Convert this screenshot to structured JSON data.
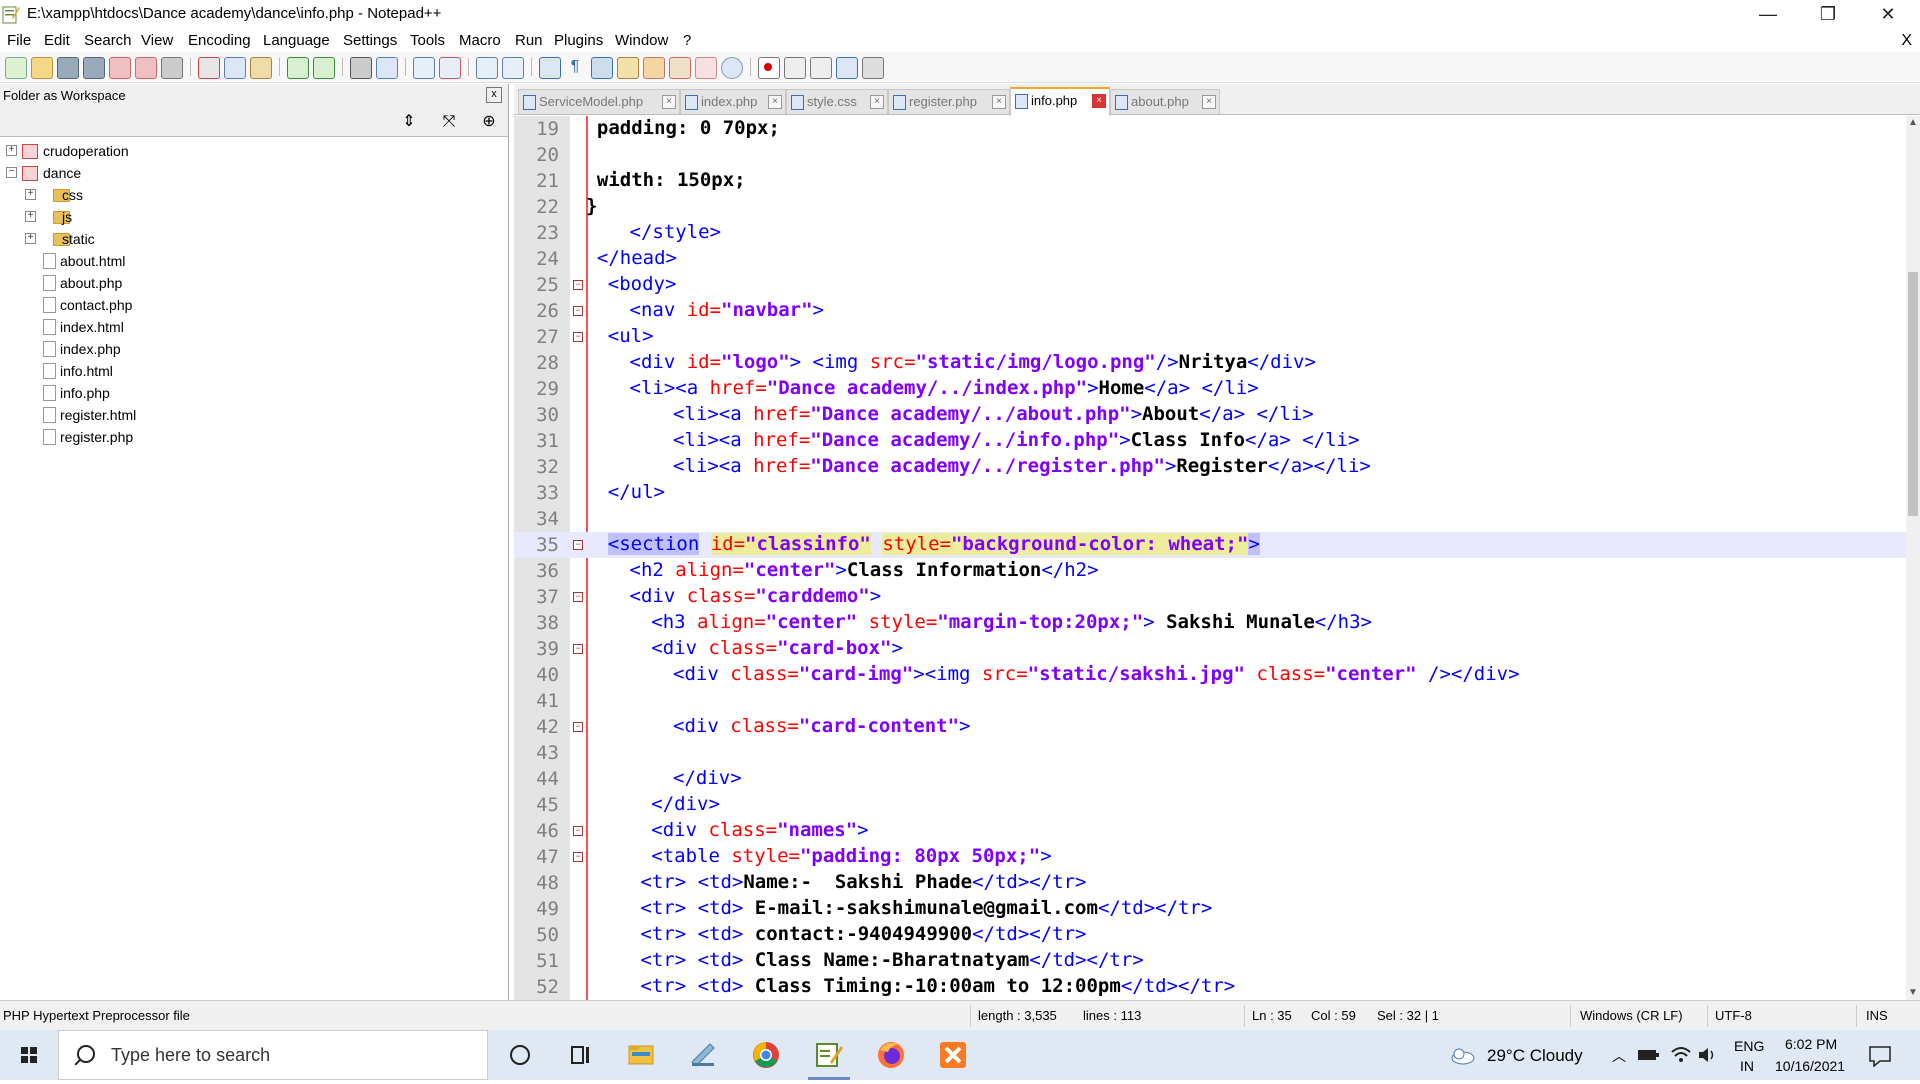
{
  "window": {
    "title": "E:\\xampp\\htdocs\\Dance academy\\dance\\info.php - Notepad++",
    "minimize": "—",
    "maximize": "❐",
    "close": "✕"
  },
  "menu": {
    "items": [
      "File",
      "Edit",
      "Search",
      "View",
      "Encoding",
      "Language",
      "Settings",
      "Tools",
      "Macro",
      "Run",
      "Plugins",
      "Window",
      "?"
    ],
    "close": "X"
  },
  "workspace": {
    "title": "Folder as Workspace",
    "close": "x",
    "tools": [
      "⇕",
      "⤧",
      "⊕"
    ],
    "tree": [
      {
        "label": "crudoperation",
        "type": "project",
        "level": 0,
        "expander": "+"
      },
      {
        "label": "dance",
        "type": "project",
        "level": 0,
        "expander": "−"
      },
      {
        "label": "css",
        "type": "folder",
        "level": 1,
        "expander": "+"
      },
      {
        "label": "js",
        "type": "folder",
        "level": 1,
        "expander": "+"
      },
      {
        "label": "static",
        "type": "folder",
        "level": 1,
        "expander": "+"
      },
      {
        "label": "about.html",
        "type": "file",
        "level": 1
      },
      {
        "label": "about.php",
        "type": "file",
        "level": 1
      },
      {
        "label": "contact.php",
        "type": "file",
        "level": 1
      },
      {
        "label": "index.html",
        "type": "file",
        "level": 1
      },
      {
        "label": "index.php",
        "type": "file",
        "level": 1
      },
      {
        "label": "info.html",
        "type": "file",
        "level": 1
      },
      {
        "label": "info.php",
        "type": "file",
        "level": 1
      },
      {
        "label": "register.html",
        "type": "file",
        "level": 1
      },
      {
        "label": "register.php",
        "type": "file",
        "level": 1
      }
    ]
  },
  "tabs": [
    {
      "label": "ServiceModel.php",
      "active": false
    },
    {
      "label": "index.php",
      "active": false
    },
    {
      "label": "style.css",
      "active": false
    },
    {
      "label": "register.php",
      "active": false
    },
    {
      "label": "info.php",
      "active": true
    },
    {
      "label": "about.php",
      "active": false
    }
  ],
  "editor": {
    "lines": [
      {
        "n": "19",
        "fold": "",
        "parts": [
          [
            "txt",
            "padding: 0 70px;"
          ]
        ],
        "indent": 1
      },
      {
        "n": "20",
        "fold": "",
        "parts": [],
        "indent": 0
      },
      {
        "n": "21",
        "fold": "",
        "parts": [
          [
            "txt",
            "width: 150px;"
          ]
        ],
        "indent": 1
      },
      {
        "n": "22",
        "fold": "",
        "parts": [
          [
            "txt",
            "}"
          ]
        ],
        "indent": 0
      },
      {
        "n": "23",
        "fold": "",
        "parts": [
          [
            "tag",
            "</style>"
          ]
        ],
        "indent": 4
      },
      {
        "n": "24",
        "fold": "",
        "parts": [
          [
            "tag",
            "</head>"
          ]
        ],
        "indent": 1
      },
      {
        "n": "25",
        "fold": "−",
        "parts": [
          [
            "tag",
            "<body>"
          ]
        ],
        "indent": 2
      },
      {
        "n": "26",
        "fold": "−",
        "parts": [
          [
            "tag",
            "<nav "
          ],
          [
            "attr",
            "id="
          ],
          [
            "val",
            "\"navbar\""
          ],
          [
            "tag",
            ">"
          ]
        ],
        "indent": 4
      },
      {
        "n": "27",
        "fold": "−",
        "parts": [
          [
            "tag",
            "<ul>"
          ]
        ],
        "indent": 2
      },
      {
        "n": "28",
        "fold": "",
        "parts": [
          [
            "tag",
            "<div "
          ],
          [
            "attr",
            "id="
          ],
          [
            "val",
            "\"logo\""
          ],
          [
            "tag",
            "> <img "
          ],
          [
            "attr",
            "src="
          ],
          [
            "val",
            "\"static/img/logo.png\""
          ],
          [
            "tag",
            "/>"
          ],
          [
            "txt",
            "Nritya"
          ],
          [
            "tag",
            "</div>"
          ]
        ],
        "indent": 4
      },
      {
        "n": "29",
        "fold": "",
        "parts": [
          [
            "tag",
            "<li><a "
          ],
          [
            "attr",
            "href="
          ],
          [
            "val",
            "\"Dance academy/../index.php\""
          ],
          [
            "tag",
            ">"
          ],
          [
            "txt",
            "Home"
          ],
          [
            "tag",
            "</a> </li>"
          ]
        ],
        "indent": 4
      },
      {
        "n": "30",
        "fold": "",
        "parts": [
          [
            "tag",
            "<li><a "
          ],
          [
            "attr",
            "href="
          ],
          [
            "val",
            "\"Dance academy/../about.php\""
          ],
          [
            "tag",
            ">"
          ],
          [
            "txt",
            "About"
          ],
          [
            "tag",
            "</a> </li>"
          ]
        ],
        "indent": 8
      },
      {
        "n": "31",
        "fold": "",
        "parts": [
          [
            "tag",
            "<li><a "
          ],
          [
            "attr",
            "href="
          ],
          [
            "val",
            "\"Dance academy/../info.php\""
          ],
          [
            "tag",
            ">"
          ],
          [
            "txt",
            "Class Info"
          ],
          [
            "tag",
            "</a> </li>"
          ]
        ],
        "indent": 8
      },
      {
        "n": "32",
        "fold": "",
        "parts": [
          [
            "tag",
            "<li><a "
          ],
          [
            "attr",
            "href="
          ],
          [
            "val",
            "\"Dance academy/../register.php\""
          ],
          [
            "tag",
            ">"
          ],
          [
            "txt",
            "Register"
          ],
          [
            "tag",
            "</a></li>"
          ]
        ],
        "indent": 8
      },
      {
        "n": "33",
        "fold": "",
        "parts": [
          [
            "tag",
            "</ul>"
          ]
        ],
        "indent": 2
      },
      {
        "n": "34",
        "fold": "",
        "parts": [],
        "indent": 0
      },
      {
        "n": "35",
        "fold": "−",
        "current": true,
        "parts": [
          [
            "tag hlsel",
            "<section"
          ],
          [
            "txt",
            " "
          ],
          [
            "attr hlfind",
            "id="
          ],
          [
            "val hlfind",
            "\"classinfo\""
          ],
          [
            "txt",
            " "
          ],
          [
            "attr hlfind",
            "style="
          ],
          [
            "val hlfind",
            "\"background-color: wheat;\""
          ],
          [
            "tag hlsel",
            ">"
          ]
        ],
        "indent": 2
      },
      {
        "n": "36",
        "fold": "",
        "parts": [
          [
            "tag",
            "<h2 "
          ],
          [
            "attr",
            "align="
          ],
          [
            "val",
            "\"center\""
          ],
          [
            "tag",
            ">"
          ],
          [
            "txt",
            "Class Information"
          ],
          [
            "tag",
            "</h2>"
          ]
        ],
        "indent": 4
      },
      {
        "n": "37",
        "fold": "−",
        "parts": [
          [
            "tag",
            "<div "
          ],
          [
            "attr",
            "class="
          ],
          [
            "val",
            "\"carddemo\""
          ],
          [
            "tag",
            ">"
          ]
        ],
        "indent": 4
      },
      {
        "n": "38",
        "fold": "",
        "parts": [
          [
            "tag",
            "<h3 "
          ],
          [
            "attr",
            "align="
          ],
          [
            "val",
            "\"center\""
          ],
          [
            "txt",
            " "
          ],
          [
            "attr",
            "style="
          ],
          [
            "val",
            "\"margin-top:20px;\""
          ],
          [
            "tag",
            ">"
          ],
          [
            "txt",
            " Sakshi Munale"
          ],
          [
            "tag",
            "</h3>"
          ]
        ],
        "indent": 6
      },
      {
        "n": "39",
        "fold": "−",
        "parts": [
          [
            "tag",
            "<div "
          ],
          [
            "attr",
            "class="
          ],
          [
            "val",
            "\"card-box\""
          ],
          [
            "tag",
            ">"
          ]
        ],
        "indent": 6
      },
      {
        "n": "40",
        "fold": "",
        "parts": [
          [
            "tag",
            "<div "
          ],
          [
            "attr",
            "class="
          ],
          [
            "val",
            "\"card-img\""
          ],
          [
            "tag",
            "><img "
          ],
          [
            "attr",
            "src="
          ],
          [
            "val",
            "\"static/sakshi.jpg\""
          ],
          [
            "txt",
            " "
          ],
          [
            "attr",
            "class="
          ],
          [
            "val",
            "\"center\""
          ],
          [
            "tag",
            " /></div>"
          ]
        ],
        "indent": 8
      },
      {
        "n": "41",
        "fold": "",
        "parts": [],
        "indent": 0
      },
      {
        "n": "42",
        "fold": "−",
        "parts": [
          [
            "tag",
            "<div "
          ],
          [
            "attr",
            "class="
          ],
          [
            "val",
            "\"card-content\""
          ],
          [
            "tag",
            ">"
          ]
        ],
        "indent": 8
      },
      {
        "n": "43",
        "fold": "",
        "parts": [],
        "indent": 0
      },
      {
        "n": "44",
        "fold": "",
        "parts": [
          [
            "tag",
            "</div>"
          ]
        ],
        "indent": 8
      },
      {
        "n": "45",
        "fold": "",
        "parts": [
          [
            "tag",
            "</div>"
          ]
        ],
        "indent": 6
      },
      {
        "n": "46",
        "fold": "−",
        "parts": [
          [
            "tag",
            "<div "
          ],
          [
            "attr",
            "class="
          ],
          [
            "val",
            "\"names\""
          ],
          [
            "tag",
            ">"
          ]
        ],
        "indent": 6
      },
      {
        "n": "47",
        "fold": "−",
        "parts": [
          [
            "tag",
            "<table "
          ],
          [
            "attr",
            "style="
          ],
          [
            "val",
            "\"padding: 80px 50px;\""
          ],
          [
            "tag",
            ">"
          ]
        ],
        "indent": 6
      },
      {
        "n": "48",
        "fold": "",
        "parts": [
          [
            "tag",
            "<tr> <td>"
          ],
          [
            "txt",
            "Name:-  Sakshi Phade"
          ],
          [
            "tag",
            "</td></tr>"
          ]
        ],
        "indent": 5
      },
      {
        "n": "49",
        "fold": "",
        "parts": [
          [
            "tag",
            "<tr> <td> "
          ],
          [
            "txt",
            "E-mail:-sakshimunale@gmail.com"
          ],
          [
            "tag",
            "</td></tr>"
          ]
        ],
        "indent": 5
      },
      {
        "n": "50",
        "fold": "",
        "parts": [
          [
            "tag",
            "<tr> <td> "
          ],
          [
            "txt",
            "contact:-9404949900"
          ],
          [
            "tag",
            "</td></tr>"
          ]
        ],
        "indent": 5
      },
      {
        "n": "51",
        "fold": "",
        "parts": [
          [
            "tag",
            "<tr> <td> "
          ],
          [
            "txt",
            "Class Name:-Bharatnatyam"
          ],
          [
            "tag",
            "</td></tr>"
          ]
        ],
        "indent": 5
      },
      {
        "n": "52",
        "fold": "",
        "parts": [
          [
            "tag",
            "<tr> <td> "
          ],
          [
            "txt",
            "Class Timing:-10:00am to 12:00pm"
          ],
          [
            "tag",
            "</td></tr>"
          ]
        ],
        "indent": 5
      }
    ]
  },
  "status": {
    "filetype": "PHP Hypertext Preprocessor file",
    "length": "length : 3,535",
    "lines": "lines : 113",
    "ln": "Ln : 35",
    "col": "Col : 59",
    "sel": "Sel : 32 | 1",
    "eol": "Windows (CR LF)",
    "encoding": "UTF-8",
    "mode": "INS"
  },
  "taskbar": {
    "search_placeholder": "Type here to search",
    "weather": "29°C  Cloudy",
    "lang1": "ENG",
    "lang2": "IN",
    "time": "6:02 PM",
    "date": "10/16/2021"
  },
  "colors": {
    "tag": "#0000ff",
    "attr": "#ff0000",
    "value": "#8000ff",
    "current_line": "#e8e8ff",
    "active_tab_accent": "#f5a623"
  }
}
